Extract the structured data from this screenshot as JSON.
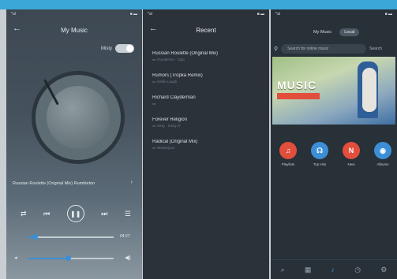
{
  "colors": {
    "accent": "#3c8fd6",
    "red": "#e24e3c"
  },
  "status": {
    "left": "*al",
    "right": "■ ▬"
  },
  "screen1": {
    "title": "My Music",
    "misty_label": "Misty",
    "song": "Russian Roulette (Original Mix) Rumbleton",
    "time": "04:27"
  },
  "screen2": {
    "title": "Recent",
    "items": [
      {
        "title": "Russian Roulette (Original Mix)",
        "sub": "Rumbleton · 32pt"
      },
      {
        "title": "Rumors (Tropka Remix)",
        "sub": "Nellie Laugh"
      },
      {
        "title": "Richard Clayderman",
        "sub": ""
      },
      {
        "title": "Forever Religion",
        "sub": "Ding · Song 07"
      },
      {
        "title": "Radical (Original Mix)",
        "sub": "Blasterjaxx"
      }
    ]
  },
  "screen3": {
    "tabs": [
      "My Music",
      "Local"
    ],
    "search_placeholder": "Search for online music",
    "more": "Search",
    "banner_text": "MUSIC",
    "categories": [
      {
        "label": "Playlists",
        "color": "#e24e3c",
        "glyph": "♫"
      },
      {
        "label": "Top Hits",
        "color": "#3c8fd6",
        "glyph": "☊"
      },
      {
        "label": "New",
        "color": "#e24e3c",
        "glyph": "N"
      },
      {
        "label": "Albums",
        "color": "#3c8fd6",
        "glyph": "◉"
      }
    ],
    "nav": [
      "⌕",
      "▦",
      "♪",
      "◷",
      "⚙"
    ]
  }
}
